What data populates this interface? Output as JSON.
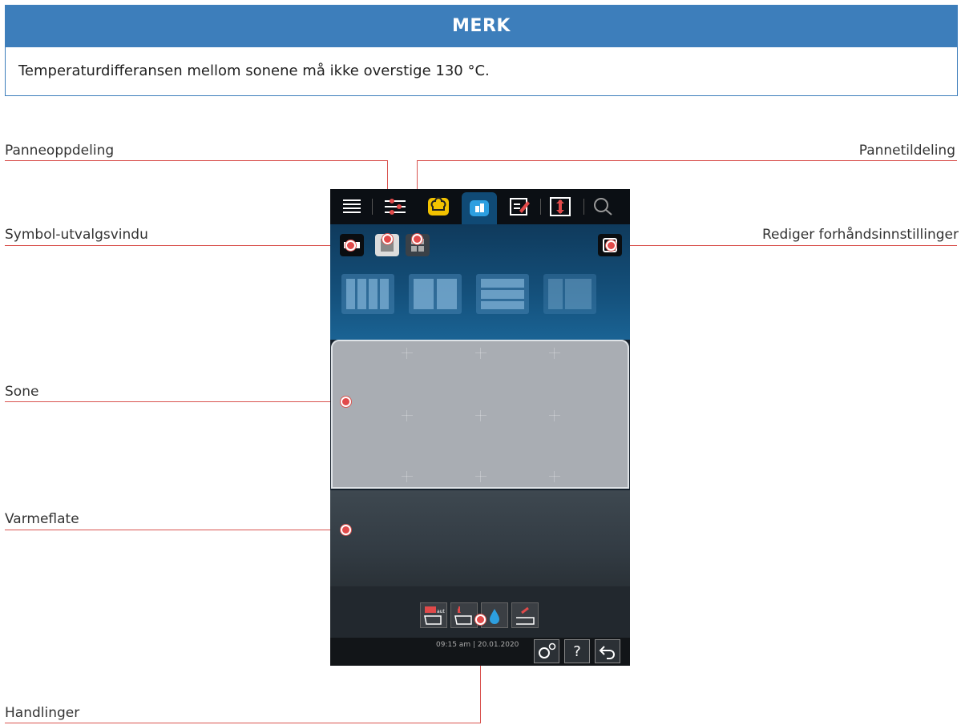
{
  "note": {
    "title": "MERK",
    "text": "Temperaturdifferansen mellom sonene må ikke overstige 130 °C."
  },
  "callouts": {
    "panneoppdeling": "Panneoppdeling",
    "pannetildeling": "Pannetildeling",
    "symbol_utvalgsvindu": "Symbol-utvalgsvindu",
    "rediger": "Rediger forhåndsinnstillinger",
    "sone": "Sone",
    "varmeflate": "Varmeflate",
    "handlinger": "Handlinger"
  },
  "device": {
    "tabs": [
      "menu-icon",
      "settings-list-icon",
      "chef-hat-icon",
      "zone-layout-icon",
      "edit-icon",
      "temperature-icon",
      "search-icon"
    ],
    "actions": [
      "auto-icon",
      "pan-icon",
      "water-drop-icon",
      "tray-icon"
    ],
    "time": "09:15 am",
    "date": "20.01.2020",
    "system_buttons": {
      "settings": "settings-icon",
      "help": "?",
      "back": "back-icon"
    },
    "accent": "#e14a4a",
    "active_tab_color": "#104a75",
    "zone_color": "#a9adb3"
  }
}
